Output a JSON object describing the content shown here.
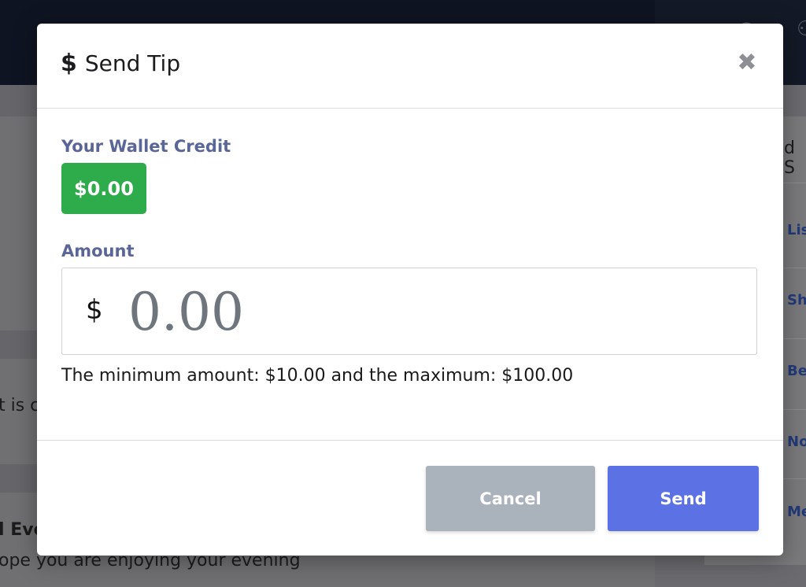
{
  "background": {
    "right_partial_title": "d S",
    "right_items": [
      "Lis",
      "Sh",
      "Be",
      "No",
      "Me"
    ],
    "left_partial_text": "t is c",
    "bottom_bold": "l Eve",
    "bottom_text": "ope you are enjoying your evening"
  },
  "modal": {
    "title_icon": "$",
    "title": "Send Tip",
    "close_icon": "✖",
    "wallet_label": "Your Wallet Credit",
    "wallet_value": "$0.00",
    "amount_label": "Amount",
    "currency_symbol": "$",
    "amount_placeholder": "0.00",
    "amount_value": "",
    "hint": "The minimum amount: $10.00 and the maximum: $100.00",
    "cancel_label": "Cancel",
    "send_label": "Send"
  },
  "colors": {
    "badge_green": "#2eab4a",
    "send_blue": "#5c71e3",
    "cancel_gray": "#aab2bb",
    "label_blue": "#5a6796"
  }
}
